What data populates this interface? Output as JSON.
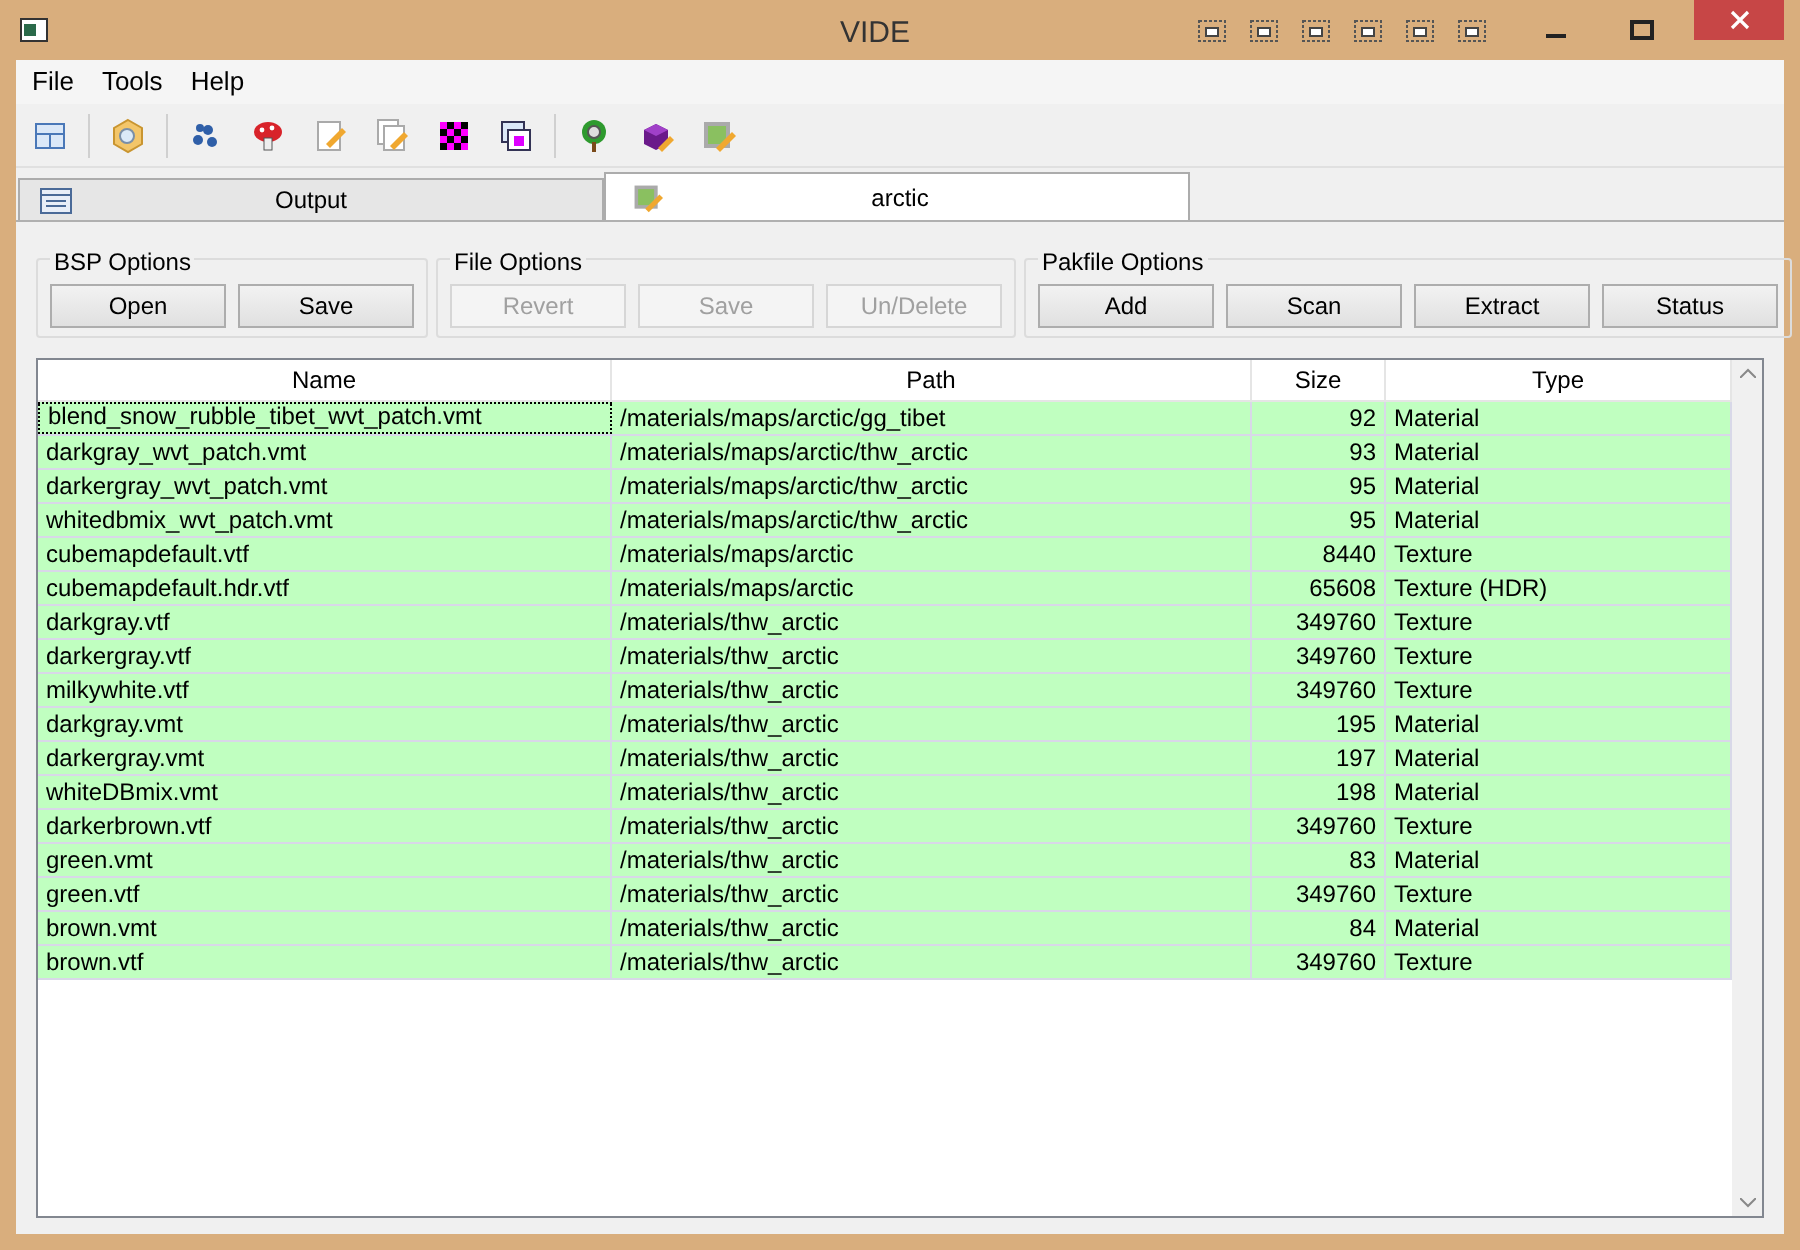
{
  "window": {
    "title": "VIDE"
  },
  "menu": [
    "File",
    "Tools",
    "Help"
  ],
  "tabs": [
    {
      "label": "Output",
      "selected": false
    },
    {
      "label": "arctic",
      "selected": true
    }
  ],
  "groups": [
    {
      "title": "BSP Options",
      "buttons": [
        {
          "label": "Open",
          "disabled": false
        },
        {
          "label": "Save",
          "disabled": false
        }
      ]
    },
    {
      "title": "File Options",
      "buttons": [
        {
          "label": "Revert",
          "disabled": true
        },
        {
          "label": "Save",
          "disabled": true
        },
        {
          "label": "Un/Delete",
          "disabled": true
        }
      ]
    },
    {
      "title": "Pakfile Options",
      "buttons": [
        {
          "label": "Add",
          "disabled": false
        },
        {
          "label": "Scan",
          "disabled": false
        },
        {
          "label": "Extract",
          "disabled": false
        },
        {
          "label": "Status",
          "disabled": false
        }
      ]
    }
  ],
  "table": {
    "columns": [
      "Name",
      "Path",
      "Size",
      "Type"
    ],
    "rows": [
      {
        "cells": [
          "blend_snow_rubble_tibet_wvt_patch.vmt",
          "/materials/maps/arctic/gg_tibet",
          "92",
          "Material"
        ],
        "focused": true
      },
      {
        "cells": [
          "darkgray_wvt_patch.vmt",
          "/materials/maps/arctic/thw_arctic",
          "93",
          "Material"
        ],
        "focused": false
      },
      {
        "cells": [
          "darkergray_wvt_patch.vmt",
          "/materials/maps/arctic/thw_arctic",
          "95",
          "Material"
        ],
        "focused": false
      },
      {
        "cells": [
          "whitedbmix_wvt_patch.vmt",
          "/materials/maps/arctic/thw_arctic",
          "95",
          "Material"
        ],
        "focused": false
      },
      {
        "cells": [
          "cubemapdefault.vtf",
          "/materials/maps/arctic",
          "8440",
          "Texture"
        ],
        "focused": false
      },
      {
        "cells": [
          "cubemapdefault.hdr.vtf",
          "/materials/maps/arctic",
          "65608",
          "Texture (HDR)"
        ],
        "focused": false
      },
      {
        "cells": [
          "darkgray.vtf",
          "/materials/thw_arctic",
          "349760",
          "Texture"
        ],
        "focused": false
      },
      {
        "cells": [
          "darkergray.vtf",
          "/materials/thw_arctic",
          "349760",
          "Texture"
        ],
        "focused": false
      },
      {
        "cells": [
          "milkywhite.vtf",
          "/materials/thw_arctic",
          "349760",
          "Texture"
        ],
        "focused": false
      },
      {
        "cells": [
          "darkgray.vmt",
          "/materials/thw_arctic",
          "195",
          "Material"
        ],
        "focused": false
      },
      {
        "cells": [
          "darkergray.vmt",
          "/materials/thw_arctic",
          "197",
          "Material"
        ],
        "focused": false
      },
      {
        "cells": [
          "whiteDBmix.vmt",
          "/materials/thw_arctic",
          "198",
          "Material"
        ],
        "focused": false
      },
      {
        "cells": [
          "darkerbrown.vtf",
          "/materials/thw_arctic",
          "349760",
          "Texture"
        ],
        "focused": false
      },
      {
        "cells": [
          "green.vmt",
          "/materials/thw_arctic",
          "83",
          "Material"
        ],
        "focused": false
      },
      {
        "cells": [
          "green.vtf",
          "/materials/thw_arctic",
          "349760",
          "Texture"
        ],
        "focused": false
      },
      {
        "cells": [
          "brown.vmt",
          "/materials/thw_arctic",
          "84",
          "Material"
        ],
        "focused": false
      },
      {
        "cells": [
          "brown.vtf",
          "/materials/thw_arctic",
          "349760",
          "Texture"
        ],
        "focused": false
      }
    ]
  }
}
